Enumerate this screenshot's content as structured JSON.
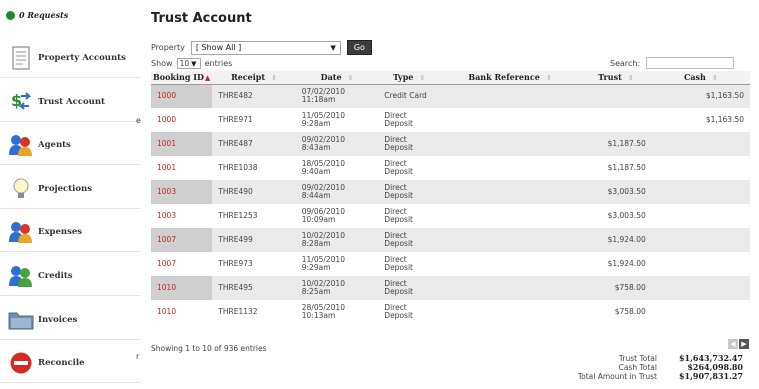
{
  "sidebar": {
    "requests_label": "0 Requests",
    "items": [
      {
        "label": "Property Accounts",
        "icon": "document-icon"
      },
      {
        "label": "Trust Account",
        "icon": "dollar-arrows-icon"
      },
      {
        "label": "Agents",
        "icon": "people-icon"
      },
      {
        "label": "Projections",
        "icon": "lightbulb-icon"
      },
      {
        "label": "Expenses",
        "icon": "people-icon"
      },
      {
        "label": "Credits",
        "icon": "people-icon"
      },
      {
        "label": "Invoices",
        "icon": "folder-icon"
      },
      {
        "label": "Reconcile",
        "icon": "no-entry-icon"
      }
    ],
    "edge_fragments": [
      "e",
      "r"
    ]
  },
  "main": {
    "title": "Trust Account",
    "property_label": "Property",
    "property_value": "[ Show All ]",
    "go_label": "Go",
    "show_label": "Show",
    "entries_value": "10",
    "entries_label": "entries",
    "search_label": "Search:"
  },
  "table": {
    "columns": [
      "Booking ID",
      "Receipt",
      "Date",
      "Type",
      "Bank Reference",
      "Trust",
      "Cash"
    ],
    "rows": [
      {
        "booking_id": "1000",
        "receipt": "THRE482",
        "date": "07/02/2010",
        "time": "11:18am",
        "type1": "Credit Card",
        "type2": "",
        "bank_ref": "",
        "trust": "",
        "cash": "$1,163.50"
      },
      {
        "booking_id": "1000",
        "receipt": "THRE971",
        "date": "11/05/2010",
        "time": "9:28am",
        "type1": "Direct",
        "type2": "Deposit",
        "bank_ref": "",
        "trust": "",
        "cash": "$1,163.50"
      },
      {
        "booking_id": "1001",
        "receipt": "THRE487",
        "date": "09/02/2010",
        "time": "8:43am",
        "type1": "Direct",
        "type2": "Deposit",
        "bank_ref": "",
        "trust": "$1,187.50",
        "cash": ""
      },
      {
        "booking_id": "1001",
        "receipt": "THRE1038",
        "date": "18/05/2010",
        "time": "9:40am",
        "type1": "Direct",
        "type2": "Deposit",
        "bank_ref": "",
        "trust": "$1,187.50",
        "cash": ""
      },
      {
        "booking_id": "1003",
        "receipt": "THRE490",
        "date": "09/02/2010",
        "time": "8:44am",
        "type1": "Direct",
        "type2": "Deposit",
        "bank_ref": "",
        "trust": "$3,003.50",
        "cash": ""
      },
      {
        "booking_id": "1003",
        "receipt": "THRE1253",
        "date": "09/06/2010",
        "time": "10:09am",
        "type1": "Direct",
        "type2": "Deposit",
        "bank_ref": "",
        "trust": "$3,003.50",
        "cash": ""
      },
      {
        "booking_id": "1007",
        "receipt": "THRE499",
        "date": "10/02/2010",
        "time": "8:28am",
        "type1": "Direct",
        "type2": "Deposit",
        "bank_ref": "",
        "trust": "$1,924.00",
        "cash": ""
      },
      {
        "booking_id": "1007",
        "receipt": "THRE973",
        "date": "11/05/2010",
        "time": "9:29am",
        "type1": "Direct",
        "type2": "Deposit",
        "bank_ref": "",
        "trust": "$1,924.00",
        "cash": ""
      },
      {
        "booking_id": "1010",
        "receipt": "THRE495",
        "date": "10/02/2010",
        "time": "8:25am",
        "type1": "Direct",
        "type2": "Deposit",
        "bank_ref": "",
        "trust": "$758.00",
        "cash": ""
      },
      {
        "booking_id": "1010",
        "receipt": "THRE1132",
        "date": "28/05/2010",
        "time": "10:13am",
        "type1": "Direct",
        "type2": "Deposit",
        "bank_ref": "",
        "trust": "$758.00",
        "cash": ""
      }
    ],
    "showing_text": "Showing 1 to 10 of 936 entries"
  },
  "totals": [
    {
      "label": "Trust Total",
      "value": "$1,643,732.47"
    },
    {
      "label": "Cash Total",
      "value": "$264,098.80"
    },
    {
      "label": "Total Amount in Trust",
      "value": "$1,907,831.27"
    }
  ],
  "colors": {
    "accent_red": "#c0272d",
    "status_green": "#1f8a2b"
  }
}
